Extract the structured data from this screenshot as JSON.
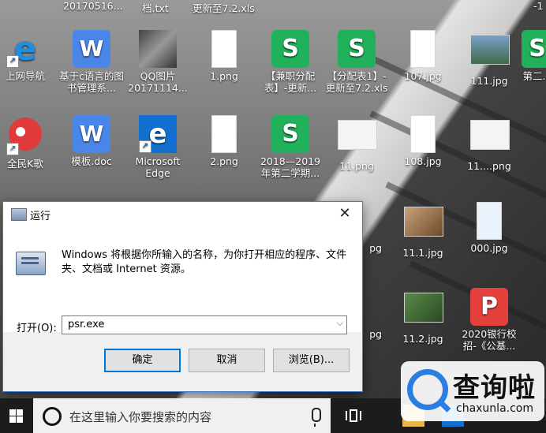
{
  "desktop": {
    "top_cut_labels": [
      "20170516...",
      "档.txt",
      "更新至7.2.xls",
      "-1"
    ],
    "icons": [
      {
        "label": "上网导航",
        "icon": "ie-icon"
      },
      {
        "label": "基于c语言的图书管理系...",
        "icon": "wps-writer-icon"
      },
      {
        "label": "QQ图片20171114...",
        "icon": "photo-icon"
      },
      {
        "label": "1.png",
        "icon": "png-thumb-icon"
      },
      {
        "label": "【兼职分配表】-更新...",
        "icon": "wps-sheet-icon"
      },
      {
        "label": "【分配表1】-更新至7.2.xls",
        "icon": "wps-sheet-icon"
      },
      {
        "label": "107.jpg",
        "icon": "jpg-thumb-icon"
      },
      {
        "label": "111.jpg",
        "icon": "jpg-thumb-icon"
      },
      {
        "label": "第二...",
        "icon": "wps-sheet-icon"
      },
      {
        "label": "全民K歌",
        "icon": "parrot-icon"
      },
      {
        "label": "模板.doc",
        "icon": "wps-writer-icon"
      },
      {
        "label": "Microsoft Edge",
        "icon": "edge-icon"
      },
      {
        "label": "2.png",
        "icon": "png-thumb-icon"
      },
      {
        "label": "2018—2019年第二学期...",
        "icon": "wps-sheet-icon"
      },
      {
        "label": "11.png",
        "icon": "png-thumb-icon"
      },
      {
        "label": "108.jpg",
        "icon": "jpg-thumb-icon"
      },
      {
        "label": "11....png",
        "icon": "png-thumb-icon"
      },
      {
        "label": "pg",
        "icon": "jpg-thumb-icon"
      },
      {
        "label": "11.1.jpg",
        "icon": "jpg-thumb-icon"
      },
      {
        "label": "000.jpg",
        "icon": "jpg-thumb-icon"
      },
      {
        "label": "pg",
        "icon": "jpg-thumb-icon"
      },
      {
        "label": "11.2.jpg",
        "icon": "jpg-thumb-icon"
      },
      {
        "label": "2020银行校招-《公基...",
        "icon": "wps-ppt-icon"
      }
    ]
  },
  "run_dialog": {
    "title": "运行",
    "description": "Windows 将根据你所输入的名称，为你打开相应的程序、文件夹、文档或 Internet 资源。",
    "open_label": "打开(O):",
    "input_value": "psr.exe",
    "ok_label": "确定",
    "cancel_label": "取消",
    "browse_label": "浏览(B)...",
    "close_glyph": "✕",
    "accent_color": "#0078d7"
  },
  "taskbar": {
    "search_placeholder": "在这里输入你要搜索的内容"
  },
  "watermark": {
    "cn_text": "查询啦",
    "en_text": "chaxunla.com"
  }
}
